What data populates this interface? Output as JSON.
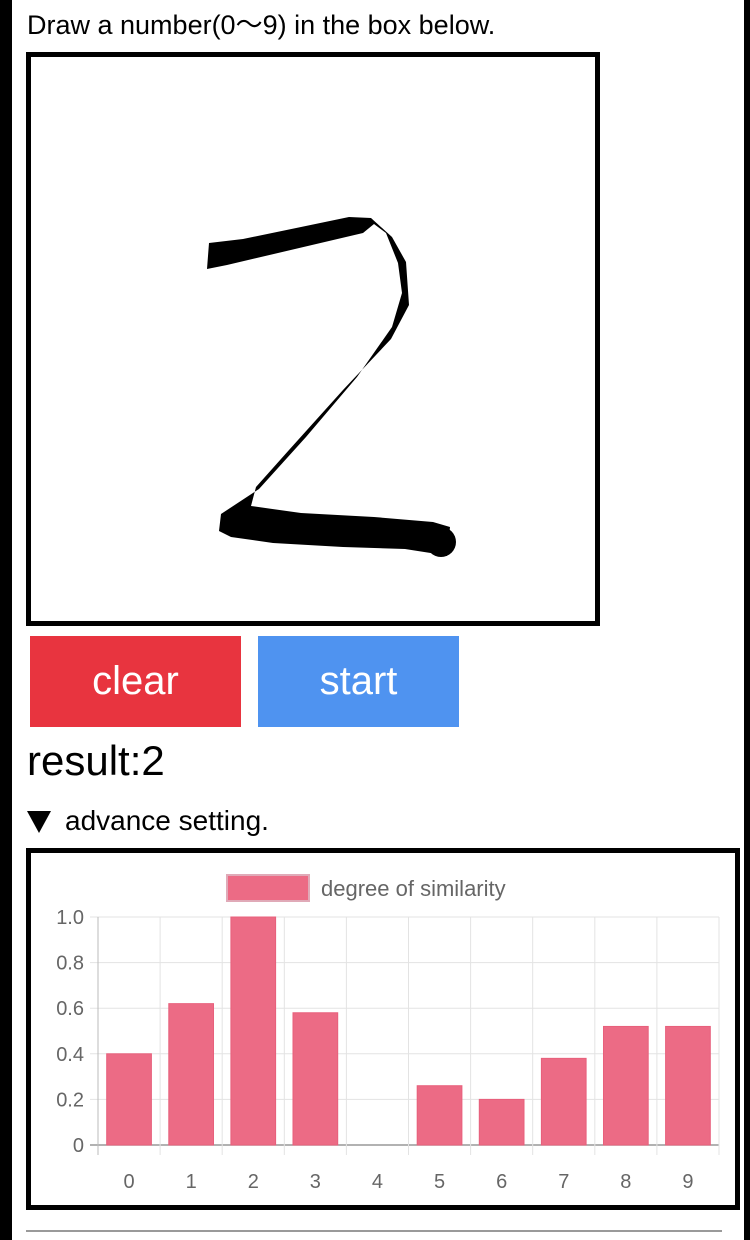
{
  "instruction": "Draw a number(0〜9) in the box below.",
  "buttons": {
    "clear_label": "clear",
    "start_label": "start"
  },
  "result_text": "result:2",
  "advance_setting_label": "advance setting.",
  "icons": {
    "advance_toggle": "triangle-down-icon"
  },
  "colors": {
    "clear_button": "#e8343f",
    "start_button": "#4f93f0",
    "bar": "#ec6b85",
    "bar_border": "#e8607c"
  },
  "chart_data": {
    "type": "bar",
    "categories": [
      "0",
      "1",
      "2",
      "3",
      "4",
      "5",
      "6",
      "7",
      "8",
      "9"
    ],
    "series": [
      {
        "name": "degree of similarity",
        "values": [
          0.4,
          0.62,
          1.0,
          0.58,
          0.0,
          0.26,
          0.2,
          0.38,
          0.52,
          0.52
        ]
      }
    ],
    "ylim": [
      0,
      1.0
    ],
    "yticks": [
      "0",
      "0.2",
      "0.4",
      "0.6",
      "0.8",
      "1.0"
    ],
    "grid": true,
    "legend": "top-center"
  }
}
